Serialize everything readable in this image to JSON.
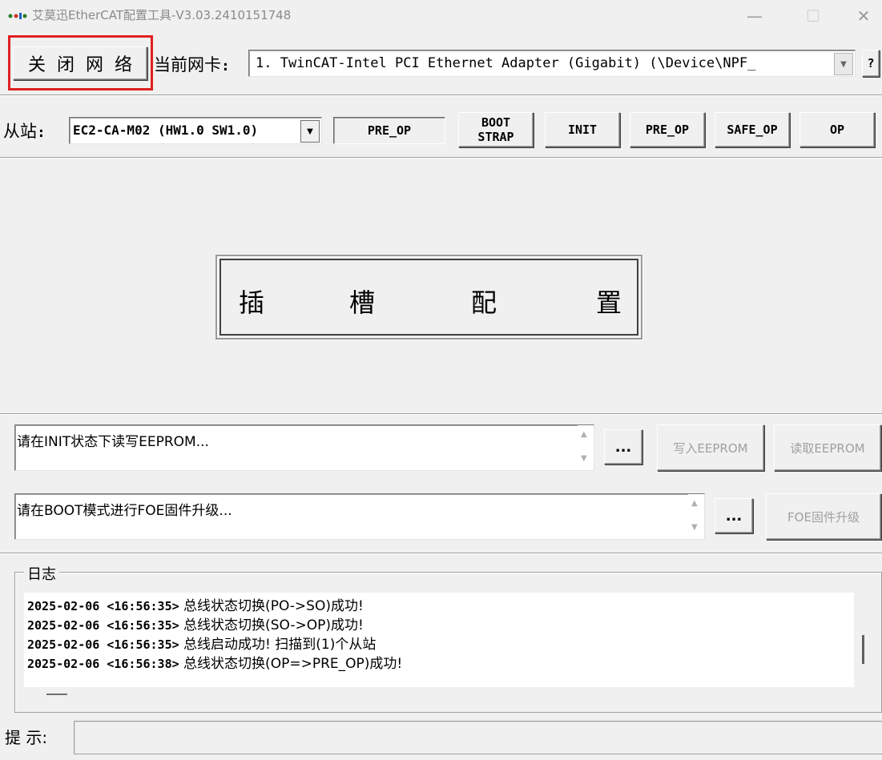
{
  "window": {
    "title": "艾莫迅EtherCAT配置工具-V3.03.2410151748",
    "minimize": "—",
    "maximize": "☐",
    "close": "✕"
  },
  "toolbar": {
    "close_network": "关闭网络",
    "nic_label": "当前网卡",
    "nic_value": "1. TwinCAT-Intel PCI Ethernet Adapter (Gigabit) (\\Device\\NPF_",
    "help": "?"
  },
  "slave": {
    "label": "从站",
    "selected": "EC2-CA-M02 (HW1.0 SW1.0)",
    "current_state": "PRE_OP",
    "boot_line1": "BOOT",
    "boot_line2": "STRAP",
    "init": "INIT",
    "pre_op": "PRE_OP",
    "safe_op": "SAFE_OP",
    "op": "OP"
  },
  "slot_config": {
    "chars": [
      "插",
      "槽",
      "配",
      "置"
    ]
  },
  "eeprom": {
    "text": "请在INIT状态下读写EEPROM...",
    "browse": "...",
    "write": "写入EEPROM",
    "read": "读取EEPROM"
  },
  "foe": {
    "text": "请在BOOT模式进行FOE固件升级...",
    "browse": "...",
    "upgrade": "FOE固件升级"
  },
  "log": {
    "title": "日志",
    "entries": [
      {
        "ts": "2025-02-06 <16:56:35>",
        "msg": " 总线状态切换(PO->SO)成功!"
      },
      {
        "ts": "2025-02-06 <16:56:35>",
        "msg": " 总线状态切换(SO->OP)成功!"
      },
      {
        "ts": "2025-02-06 <16:56:35>",
        "msg": " 总线启动成功! 扫描到(1)个从站"
      },
      {
        "ts": "2025-02-06 <16:56:38>",
        "msg": " 总线状态切换(OP=>PRE_OP)成功!"
      }
    ]
  },
  "status": {
    "hint_label": "提 示:",
    "hint_value": ""
  },
  "colors": {
    "highlight": "#e02020",
    "window_bg": "#f0f0f0"
  }
}
